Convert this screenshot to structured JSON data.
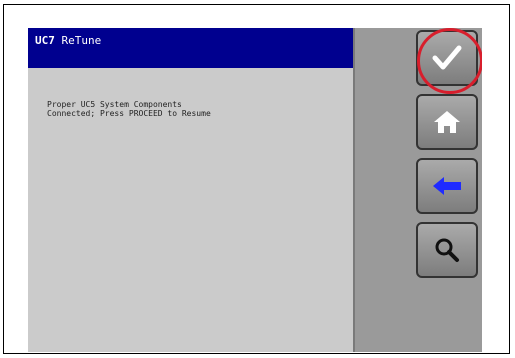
{
  "window": {
    "unit": "UC7",
    "title": "ReTune"
  },
  "message": {
    "line1": "Proper UC5 System Components",
    "line2": "Connected; Press PROCEED to Resume"
  },
  "buttons": [
    {
      "name": "proceed",
      "icon": "checkmark-icon"
    },
    {
      "name": "home",
      "icon": "home-icon"
    },
    {
      "name": "back",
      "icon": "left-arrow-icon"
    },
    {
      "name": "search",
      "icon": "magnifier-icon"
    }
  ],
  "colors": {
    "titlebar": "#00008f",
    "panel": "#cbcbcb",
    "highlight": "#d81e2c",
    "back_arrow": "#1f2bff"
  }
}
